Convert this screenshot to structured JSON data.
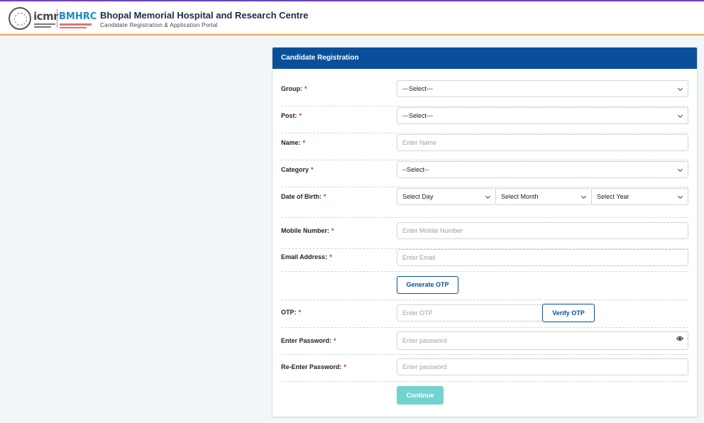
{
  "header": {
    "logo_icmr": "icmr",
    "logo_bmhrc": "BMHRC",
    "title": "Bhopal Memorial Hospital and Research Centre",
    "subtitle": "Candidate Registration & Application Portal",
    "accent_top": "#6f42c1",
    "accent_bottom": "#f0a04b"
  },
  "form": {
    "title": "Candidate Registration",
    "header_color": "#0a4f9a",
    "required_mark": "*",
    "group": {
      "label": "Group:",
      "value": "---Select---"
    },
    "post": {
      "label": "Post:",
      "value": "---Select---"
    },
    "name": {
      "label": "Name:",
      "placeholder": "Enter Name"
    },
    "category": {
      "label": "Category",
      "value": "--Select--"
    },
    "dob": {
      "label": "Date of Birth:",
      "day": "Select Day",
      "month": "Select Month",
      "year": "Select Year"
    },
    "mobile": {
      "label": "Mobile Number:",
      "placeholder": "Enter Mobile Number"
    },
    "email": {
      "label": "Email Address:",
      "placeholder": "Enter Email"
    },
    "generate_otp": "Generate OTP",
    "otp": {
      "label": "OTP:",
      "placeholder": "Enter OTP",
      "verify": "Verify OTP"
    },
    "password": {
      "label": "Enter Password:",
      "placeholder": "Enter password"
    },
    "repassword": {
      "label": "Re-Enter Password:",
      "placeholder": "Enter password"
    },
    "continue": "Continue",
    "continue_color": "#72d3d0"
  }
}
